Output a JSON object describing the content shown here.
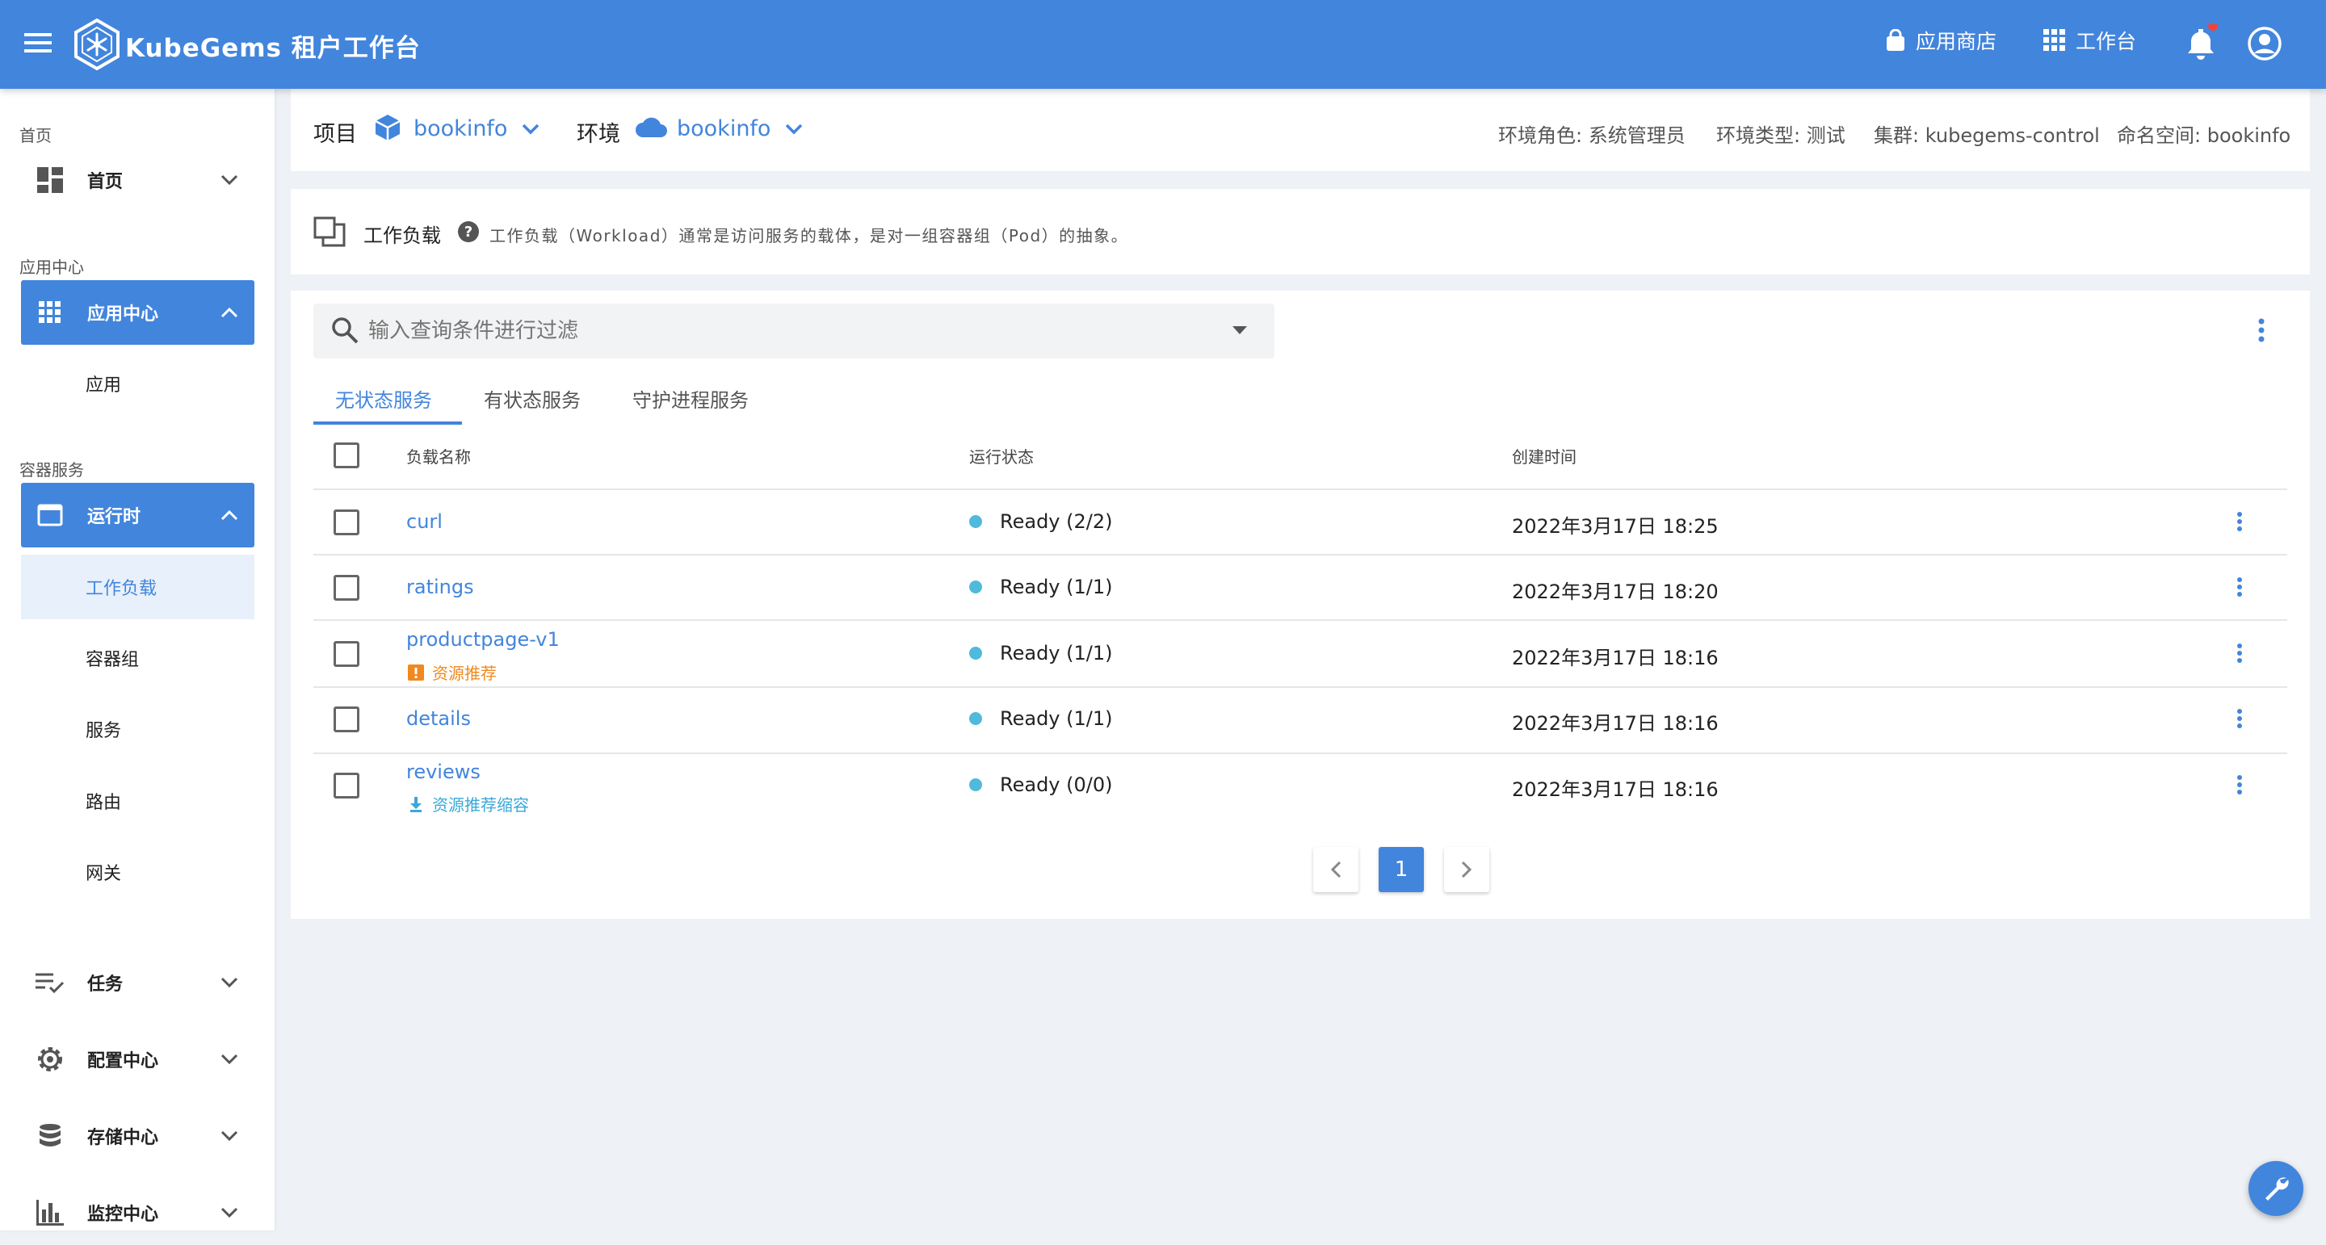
{
  "appbar": {
    "brand": "KubeGems 租户工作台",
    "store_label": "应用商店",
    "workspace_label": "工作台"
  },
  "sidebar": {
    "sections": [
      "首页",
      "应用中心",
      "容器服务"
    ],
    "home": "首页",
    "app_center": "应用中心",
    "apps": "应用",
    "runtime": "运行时",
    "runtime_items": [
      "工作负载",
      "容器组",
      "服务",
      "路由",
      "网关"
    ],
    "tasks": "任务",
    "config_center": "配置中心",
    "storage_center": "存储中心",
    "monitor_center": "监控中心"
  },
  "header": {
    "project_label": "项目",
    "project_value": "bookinfo",
    "env_label": "环境",
    "env_value": "bookinfo",
    "env_role": "环境角色: 系统管理员",
    "env_type": "环境类型: 测试",
    "cluster": "集群: kubegems-control",
    "namespace": "命名空间: bookinfo"
  },
  "workload_info": {
    "title": "工作负载",
    "description": "工作负载（Workload）通常是访问服务的载体，是对一组容器组（Pod）的抽象。"
  },
  "filter": {
    "placeholder": "输入查询条件进行过滤"
  },
  "tabs": [
    "无状态服务",
    "有状态服务",
    "守护进程服务"
  ],
  "table": {
    "headers": [
      "负载名称",
      "运行状态",
      "创建时间"
    ],
    "rows": [
      {
        "name": "curl",
        "status": "Ready (2/2)",
        "time": "2022年3月17日 18:25",
        "badge": ""
      },
      {
        "name": "ratings",
        "status": "Ready (1/1)",
        "time": "2022年3月17日 18:20",
        "badge": ""
      },
      {
        "name": "productpage-v1",
        "status": "Ready (1/1)",
        "time": "2022年3月17日 18:16",
        "badge": "资源推荐"
      },
      {
        "name": "details",
        "status": "Ready (1/1)",
        "time": "2022年3月17日 18:16",
        "badge": ""
      },
      {
        "name": "reviews",
        "status": "Ready (0/0)",
        "time": "2022年3月17日 18:16",
        "badge": "资源推荐缩容"
      }
    ]
  },
  "pagination": {
    "current": "1"
  },
  "colors": {
    "primary": "#4285dc",
    "status_dot": "#4fbadb",
    "warning": "#f0891e",
    "info": "#3aa8d8"
  }
}
